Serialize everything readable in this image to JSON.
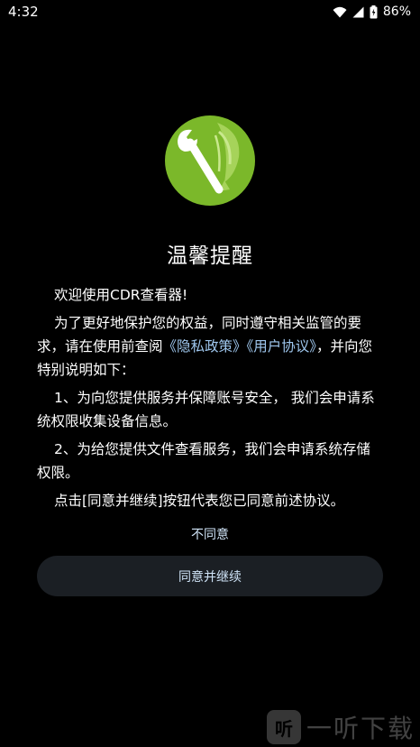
{
  "status_bar": {
    "time": "4:32",
    "battery": "86%"
  },
  "dialog": {
    "title": "温馨提醒",
    "greeting": "欢迎使用CDR查看器!",
    "para1_a": "为了更好地保护您的权益，同时遵守相关监管的要求，请在使用前查阅",
    "privacy_link": "《隐私政策》",
    "user_link": "《用户协议》",
    "para1_b": "，并向您特别说明如下：",
    "para2": "1、为向您提供服务并保障账号安全， 我们会申请系统权限收集设备信息。",
    "para3": "2、为给您提供文件查看服务，我们会申请系统存储权限。",
    "para4": "点击[同意并继续]按钮代表您已同意前述协议。",
    "disagree_label": "不同意",
    "agree_label": "同意并继续"
  },
  "watermark": {
    "icon_char": "听",
    "text": "一听下载"
  },
  "colors": {
    "background": "#000000",
    "link": "#9fc7ee",
    "button_bg": "#1b1f24",
    "logo_green": "#7bb82a"
  },
  "icons": [
    "wifi-icon",
    "signal-icon",
    "battery-icon",
    "app-logo-icon"
  ]
}
